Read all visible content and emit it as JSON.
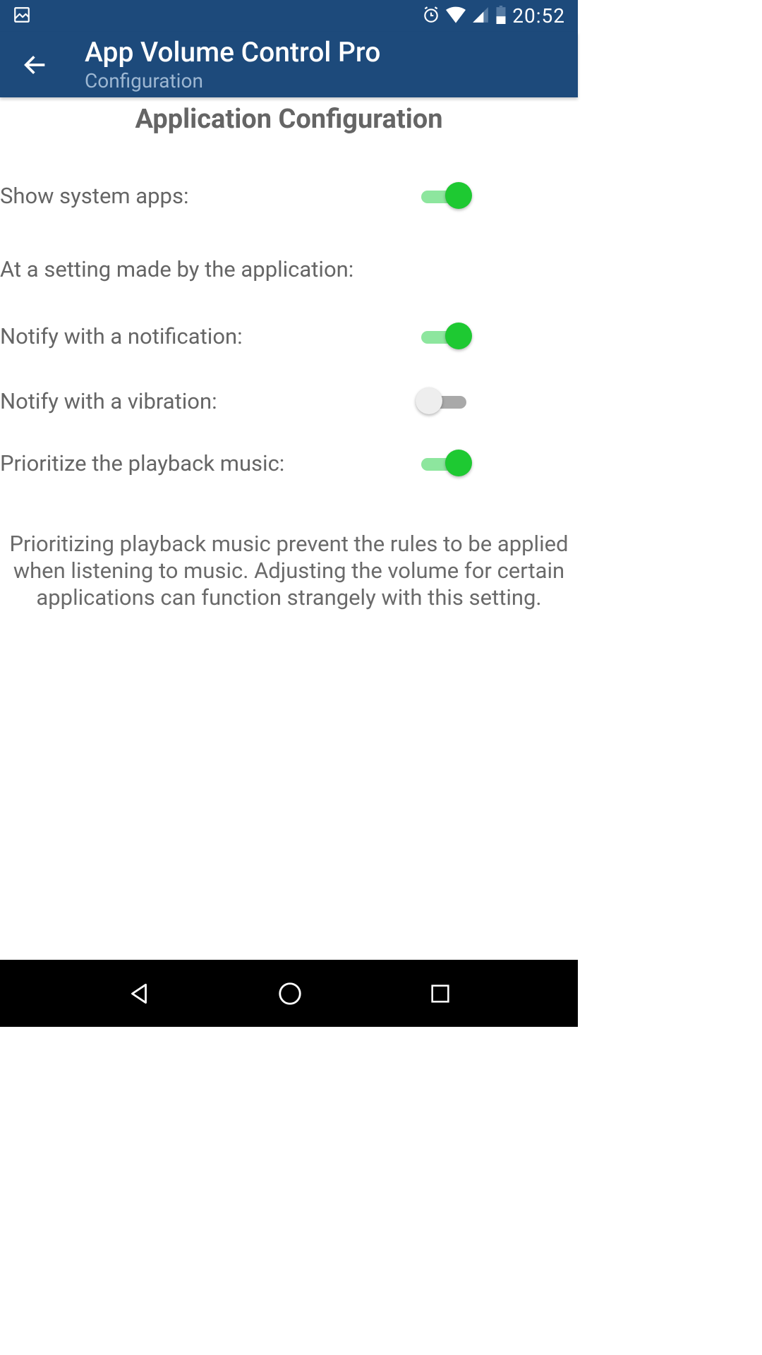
{
  "status": {
    "time": "20:52"
  },
  "header": {
    "title": "App Volume Control Pro",
    "subtitle": "Configuration"
  },
  "section": {
    "title": "Application Configuration",
    "show_system_apps": {
      "label": "Show system apps:",
      "value": true
    },
    "subheader": "At a setting made by the application:",
    "notify_notification": {
      "label": "Notify with a notification:",
      "value": true
    },
    "notify_vibration": {
      "label": "Notify with a vibration:",
      "value": false
    },
    "prioritize_playback": {
      "label": "Prioritize the playback music:",
      "value": true
    },
    "description": "Prioritizing playback music prevent the rules to be applied when listening to music. Adjusting the volume for certain applications can function strangely with this setting."
  }
}
